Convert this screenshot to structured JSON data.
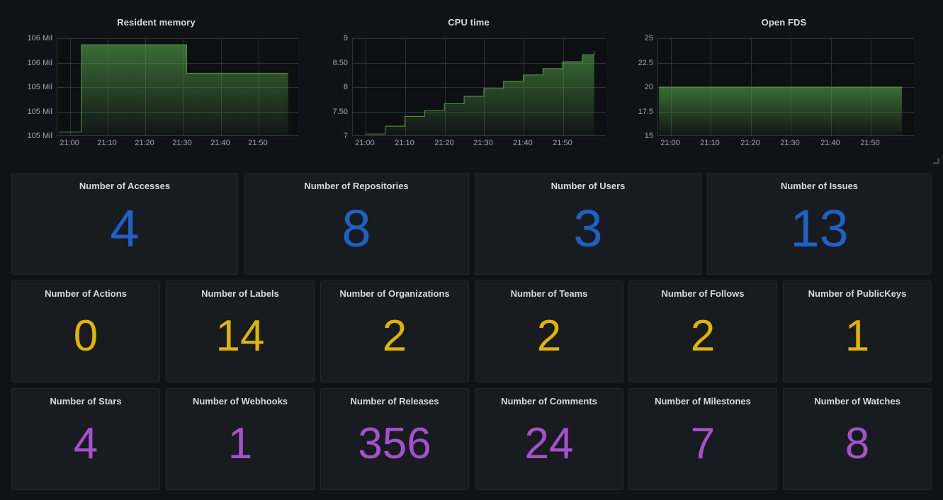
{
  "theme": {
    "page_background": "#111217",
    "panel_background": "#181b1f",
    "panel_border": "#23282e",
    "grid_color": "#2c3235",
    "text_color": "#d8d9da",
    "axis_text_color": "#9fa7b3",
    "series_green": "#56a64b",
    "blue": "#1f60c4",
    "yellow": "#e0b400",
    "purple": "#a352cc"
  },
  "graphs": [
    {
      "title": "Resident memory",
      "resize_handle": false
    },
    {
      "title": "CPU time",
      "resize_handle": false
    },
    {
      "title": "Open FDS",
      "resize_handle": true
    }
  ],
  "stat_rows": [
    {
      "color": "#1f60c4",
      "value_font_size": 74,
      "panels": [
        {
          "title": "Number of Accesses",
          "value": "4"
        },
        {
          "title": "Number of Repositories",
          "value": "8"
        },
        {
          "title": "Number of Users",
          "value": "3"
        },
        {
          "title": "Number of Issues",
          "value": "13"
        }
      ]
    },
    {
      "color": "#e0b400",
      "value_font_size": 62,
      "panels": [
        {
          "title": "Number of Actions",
          "value": "0"
        },
        {
          "title": "Number of Labels",
          "value": "14"
        },
        {
          "title": "Number of Organizations",
          "value": "2"
        },
        {
          "title": "Number of Teams",
          "value": "2"
        },
        {
          "title": "Number of Follows",
          "value": "2"
        },
        {
          "title": "Number of PublicKeys",
          "value": "1"
        }
      ]
    },
    {
      "color": "#a352cc",
      "value_font_size": 62,
      "panels": [
        {
          "title": "Number of Stars",
          "value": "4"
        },
        {
          "title": "Number of Webhooks",
          "value": "1"
        },
        {
          "title": "Number of Releases",
          "value": "356"
        },
        {
          "title": "Number of Comments",
          "value": "24"
        },
        {
          "title": "Number of Milestones",
          "value": "7"
        },
        {
          "title": "Number of Watches",
          "value": "8"
        }
      ]
    }
  ],
  "chart_data": [
    {
      "type": "area",
      "title": "Resident memory",
      "xlabel": "",
      "ylabel": "",
      "grid": true,
      "legend": "none",
      "y_ticks": [
        "105 Mil",
        "105 Mil",
        "105 Mil",
        "106 Mil",
        "106 Mil"
      ],
      "y_tick_values": [
        105.0,
        105.3,
        105.6,
        105.9,
        106.2
      ],
      "ylim": [
        105.0,
        106.2
      ],
      "x_ticks": [
        "21:00",
        "21:10",
        "21:20",
        "21:30",
        "21:40",
        "21:50"
      ],
      "series": [
        {
          "name": "Resident memory",
          "color": "#56a64b",
          "step": true,
          "x": [
            "20:57",
            "21:03",
            "21:03",
            "21:31",
            "21:31",
            "21:58"
          ],
          "values": [
            105.05,
            105.05,
            106.12,
            106.12,
            105.77,
            105.77
          ]
        }
      ]
    },
    {
      "type": "area",
      "title": "CPU time",
      "xlabel": "",
      "ylabel": "",
      "grid": true,
      "legend": "none",
      "y_ticks": [
        "7",
        "7.50",
        "8",
        "8.50",
        "9"
      ],
      "y_tick_values": [
        7,
        7.5,
        8,
        8.5,
        9
      ],
      "ylim": [
        7,
        9
      ],
      "x_ticks": [
        "21:00",
        "21:10",
        "21:20",
        "21:30",
        "21:40",
        "21:50"
      ],
      "series": [
        {
          "name": "CPU time",
          "color": "#56a64b",
          "step": true,
          "x": [
            "21:00",
            "21:05",
            "21:10",
            "21:15",
            "21:20",
            "21:25",
            "21:30",
            "21:35",
            "21:40",
            "21:45",
            "21:50",
            "21:55",
            "21:58"
          ],
          "values": [
            7.04,
            7.2,
            7.4,
            7.52,
            7.66,
            7.81,
            7.97,
            8.12,
            8.25,
            8.38,
            8.52,
            8.66,
            8.74
          ]
        }
      ]
    },
    {
      "type": "area",
      "title": "Open FDS",
      "xlabel": "",
      "ylabel": "",
      "grid": true,
      "legend": "none",
      "y_ticks": [
        "15",
        "17.5",
        "20",
        "22.5",
        "25"
      ],
      "y_tick_values": [
        15,
        17.5,
        20,
        22.5,
        25
      ],
      "ylim": [
        15,
        25
      ],
      "x_ticks": [
        "21:00",
        "21:10",
        "21:20",
        "21:30",
        "21:40",
        "21:50"
      ],
      "series": [
        {
          "name": "Open FDS",
          "color": "#56a64b",
          "step": true,
          "x": [
            "20:57",
            "21:58"
          ],
          "values": [
            20,
            20
          ]
        }
      ]
    }
  ]
}
